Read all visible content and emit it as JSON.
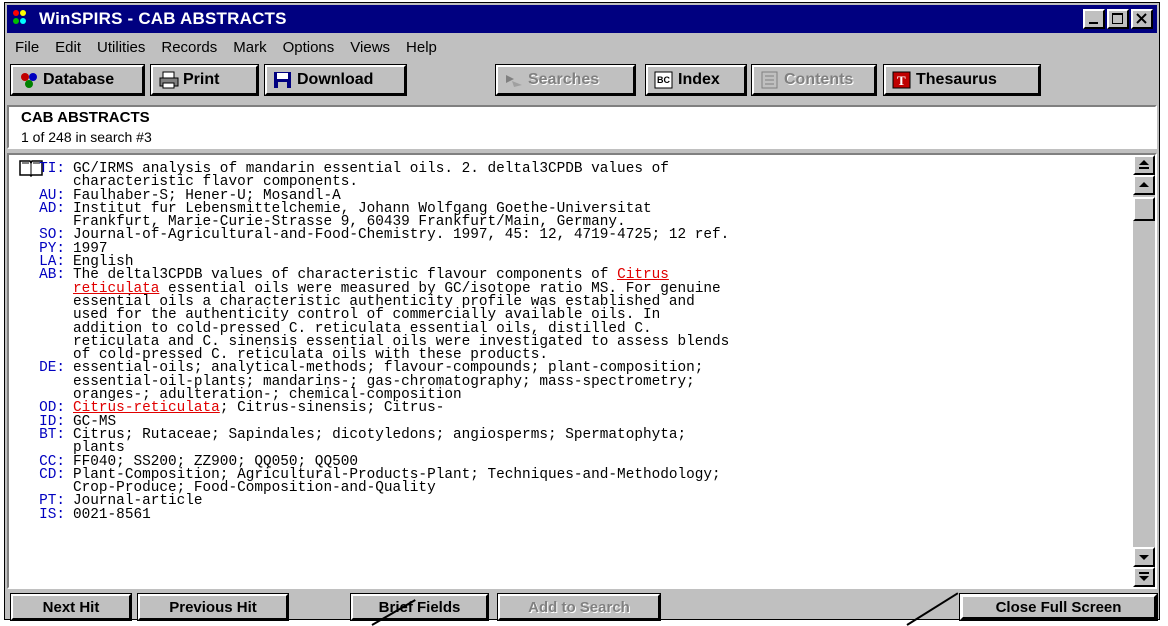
{
  "window": {
    "title": "WinSPIRS - CAB ABSTRACTS"
  },
  "menu": [
    "File",
    "Edit",
    "Utilities",
    "Records",
    "Mark",
    "Options",
    "Views",
    "Help"
  ],
  "toolbar": {
    "database": "Database",
    "print": "Print",
    "download": "Download",
    "searches": "Searches",
    "index": "Index",
    "contents": "Contents",
    "thesaurus": "Thesaurus"
  },
  "header": {
    "database_name": "CAB ABSTRACTS",
    "position": "1 of 248 in search #3"
  },
  "record": [
    {
      "label": "TI:",
      "text": "GC/IRMS analysis of mandarin essential oils. 2. deltal3CPDB values of"
    },
    {
      "label": "",
      "text": "characteristic flavor components."
    },
    {
      "label": "AU:",
      "text": "Faulhaber-S; Hener-U; Mosandl-A"
    },
    {
      "label": "AD:",
      "text": "Institut fur Lebensmittelchemie, Johann Wolfgang Goethe-Universitat"
    },
    {
      "label": "",
      "text": "Frankfurt, Marie-Curie-Strasse 9, 60439 Frankfurt/Main, Germany."
    },
    {
      "label": "SO:",
      "text": "Journal-of-Agricultural-and-Food-Chemistry. 1997, 45: 12, 4719-4725; 12 ref."
    },
    {
      "label": "PY:",
      "text": "1997"
    },
    {
      "label": "LA:",
      "text": "English"
    },
    {
      "label": "AB:",
      "text": "The deltal3CPDB values of characteristic flavour components of ",
      "hl": "Citrus"
    },
    {
      "label": "",
      "hl_start": "reticulata",
      "text": " essential oils were measured by GC/isotope ratio MS. For genuine"
    },
    {
      "label": "",
      "text": "essential oils a characteristic authenticity profile was established and"
    },
    {
      "label": "",
      "text": "used for the authenticity control of commercially available oils. In"
    },
    {
      "label": "",
      "text": "addition to cold-pressed C. reticulata essential oils, distilled C."
    },
    {
      "label": "",
      "text": "reticulata and C. sinensis essential oils were investigated to assess blends"
    },
    {
      "label": "",
      "text": "of cold-pressed C. reticulata oils with these products."
    },
    {
      "label": "DE:",
      "text": "essential-oils; analytical-methods; flavour-compounds; plant-composition;"
    },
    {
      "label": "",
      "text": "essential-oil-plants; mandarins-; gas-chromatography; mass-spectrometry;"
    },
    {
      "label": "",
      "text": "oranges-; adulteration-; chemical-composition"
    },
    {
      "label": "OD:",
      "hl_start": "Citrus-reticulata",
      "text": "; Citrus-sinensis; Citrus-"
    },
    {
      "label": "ID:",
      "text": "GC-MS"
    },
    {
      "label": "BT:",
      "text": "Citrus; Rutaceae; Sapindales; dicotyledons; angiosperms; Spermatophyta;"
    },
    {
      "label": "",
      "text": "plants"
    },
    {
      "label": "CC:",
      "text": "FF040; SS200; ZZ900; QQ050; QQ500"
    },
    {
      "label": "CD:",
      "text": "Plant-Composition; Agricultural-Products-Plant; Techniques-and-Methodology;"
    },
    {
      "label": "",
      "text": "Crop-Produce; Food-Composition-and-Quality"
    },
    {
      "label": "PT:",
      "text": "Journal-article"
    },
    {
      "label": "IS:",
      "text": "0021-8561"
    }
  ],
  "bottom": {
    "next_hit": "Next Hit",
    "previous_hit": "Previous Hit",
    "brief_fields": "Brief Fields",
    "add_to_search": "Add to Search",
    "close_full_screen": "Close Full Screen"
  },
  "colors": {
    "titlebar": "#000080",
    "field_label": "#0000c0",
    "highlight": "#e00000"
  }
}
